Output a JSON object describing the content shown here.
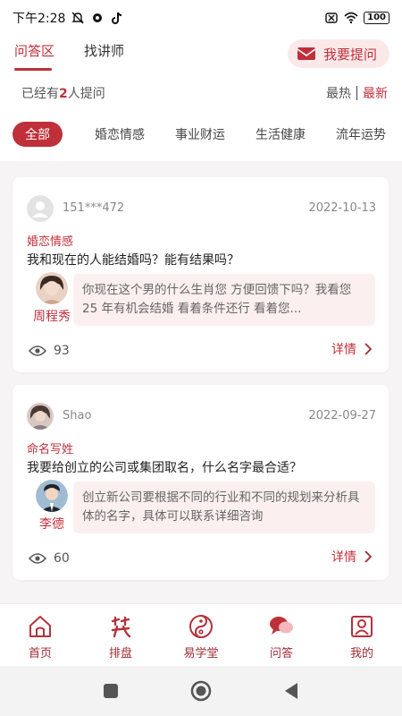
{
  "status_bar": {
    "time": "下午2:28",
    "battery": "100"
  },
  "header": {
    "tabs": [
      {
        "label": "问答区",
        "active": true
      },
      {
        "label": "找讲师",
        "active": false
      }
    ],
    "ask_button_label": "我要提问"
  },
  "subheader": {
    "asked_prefix": "已经有",
    "asked_count": "2",
    "asked_suffix": "人提问",
    "sort_hot": "最热",
    "sort_new": "最新"
  },
  "categories": [
    {
      "label": "全部",
      "active": true
    },
    {
      "label": "婚恋情感",
      "active": false
    },
    {
      "label": "事业财运",
      "active": false
    },
    {
      "label": "生活健康",
      "active": false
    },
    {
      "label": "流年运势",
      "active": false
    }
  ],
  "questions": [
    {
      "user": "151***472",
      "date": "2022-10-13",
      "category": "婚恋情感",
      "question": "我和现在的人能结婚吗？能有结果吗？",
      "teacher": "周程秀",
      "answer": "你现在这个男的什么生肖您 方便回馈下吗？我看您 25 年有机会结婚 看着条件还行 看着您...",
      "views": "93",
      "detail_label": "详情"
    },
    {
      "user": "Shao",
      "date": "2022-09-27",
      "category": "命名写姓",
      "question": "我要给创立的公司或集团取名，什么名字最合适？",
      "teacher": "李德",
      "answer": "创立新公司要根据不同的行业和不同的规划来分析具体的名字，具体可以联系详细咨询",
      "views": "60",
      "detail_label": "详情"
    }
  ],
  "tabbar": [
    {
      "label": "首页",
      "icon": "home-icon"
    },
    {
      "label": "排盘",
      "icon": "chart-calligraphy-icon"
    },
    {
      "label": "易学堂",
      "icon": "yinyang-icon"
    },
    {
      "label": "问答",
      "icon": "chat-bubbles-icon"
    },
    {
      "label": "我的",
      "icon": "profile-icon"
    }
  ],
  "colors": {
    "accent": "#c0303a",
    "accent_light": "#fbe9ea"
  }
}
